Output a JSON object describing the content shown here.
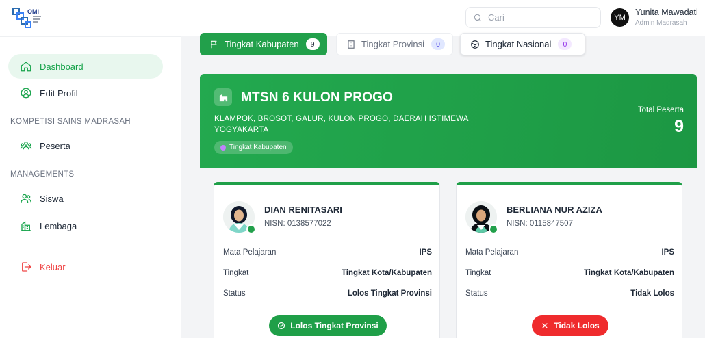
{
  "sidebar": {
    "items": [
      {
        "label": "Dashboard",
        "icon": "home-icon",
        "active": true
      },
      {
        "label": "Edit Profil",
        "icon": "user-circle-icon"
      },
      {
        "label": "Peserta",
        "icon": "users-group-icon"
      },
      {
        "label": "Siswa",
        "icon": "users-icon"
      },
      {
        "label": "Lembaga",
        "icon": "building-icon"
      },
      {
        "label": "Keluar",
        "icon": "logout-icon"
      }
    ],
    "sections": [
      "KOMPETISI SAINS MADRASAH",
      "MANAGEMENTS"
    ]
  },
  "topbar": {
    "search_placeholder": "Cari",
    "avatar_initials": "YM",
    "user_name": "Yunita Mawadati",
    "user_role": "Admin Madrasah"
  },
  "tabs": [
    {
      "label": "Tingkat Kabupaten",
      "count": "9",
      "icon": "flag-icon"
    },
    {
      "label": "Tingkat Provinsi",
      "count": "0",
      "icon": "building-icon"
    },
    {
      "label": "Tingkat Nasional",
      "count": "0",
      "icon": "globe-icon"
    }
  ],
  "school": {
    "name": "MTSN 6 KULON PROGO",
    "address": "KLAMPOK, BROSOT, GALUR, KULON PROGO, DAERAH ISTIMEWA YOGYAKARTA",
    "level_chip": "Tingkat Kabupaten",
    "total_label": "Total Peserta",
    "total": "9"
  },
  "labels": {
    "subject": "Mata Pelajaran",
    "level": "Tingkat",
    "status": "Status"
  },
  "participants": [
    {
      "name": "DIAN RENITASARI",
      "nisn": "NISN: 0138577022",
      "subject": "IPS",
      "level": "Tingkat Kota/Kabupaten",
      "status": "Lolos Tingkat Provinsi",
      "button": "Lolos Tingkat Provinsi"
    },
    {
      "name": "BERLIANA NUR AZIZA",
      "nisn": "NISN: 0115847507",
      "subject": "IPS",
      "level": "Tingkat Kota/Kabupaten",
      "status": "Tidak Lolos",
      "button": "Tidak Lolos"
    }
  ],
  "colors": {
    "primary": "#22a04b",
    "danger": "#ef2b2d",
    "active_bg": "#e8f7ee"
  }
}
